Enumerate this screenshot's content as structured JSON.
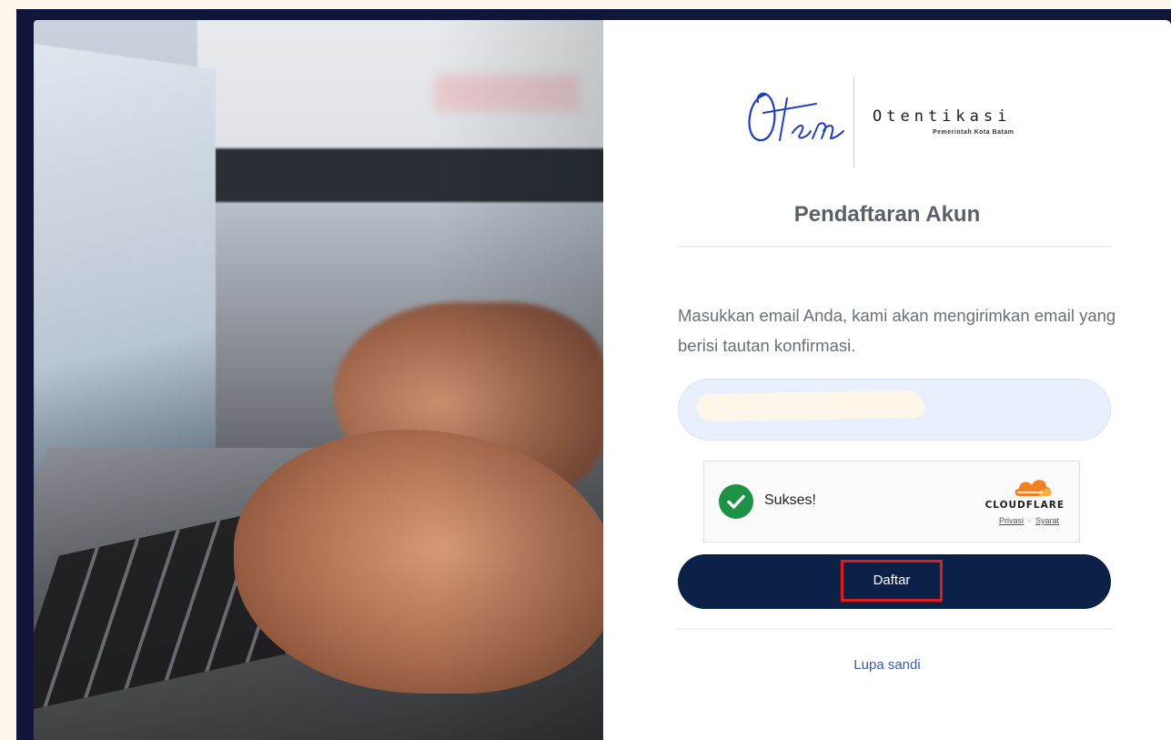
{
  "brand": {
    "title": "Otentikasi",
    "subtitle": "Pemerintah Kota Batam",
    "script_logo": "Oten"
  },
  "form": {
    "heading": "Pendaftaran Akun",
    "description": "Masukkan email Anda, kami akan mengirimkan email yang berisi tautan konfirmasi.",
    "email_value": "",
    "email_placeholder": "",
    "submit_label": "Daftar",
    "forgot_link": "Lupa sandi"
  },
  "captcha": {
    "status": "Sukses!",
    "provider": "CLOUDFLARE",
    "privacy_link": "Privasi",
    "separator": "·",
    "terms_link": "Syarat"
  },
  "colors": {
    "primary_button": "#0b2148",
    "heading": "#5b6068",
    "link": "#3e5aa6",
    "success": "#1d9145",
    "cloudflare_orange": "#f38020",
    "highlight": "#e01d1d",
    "input_bg": "#e8f0fe"
  },
  "icons": {
    "success": "check-circle-icon",
    "cloudflare": "cloudflare-cloud-icon"
  }
}
